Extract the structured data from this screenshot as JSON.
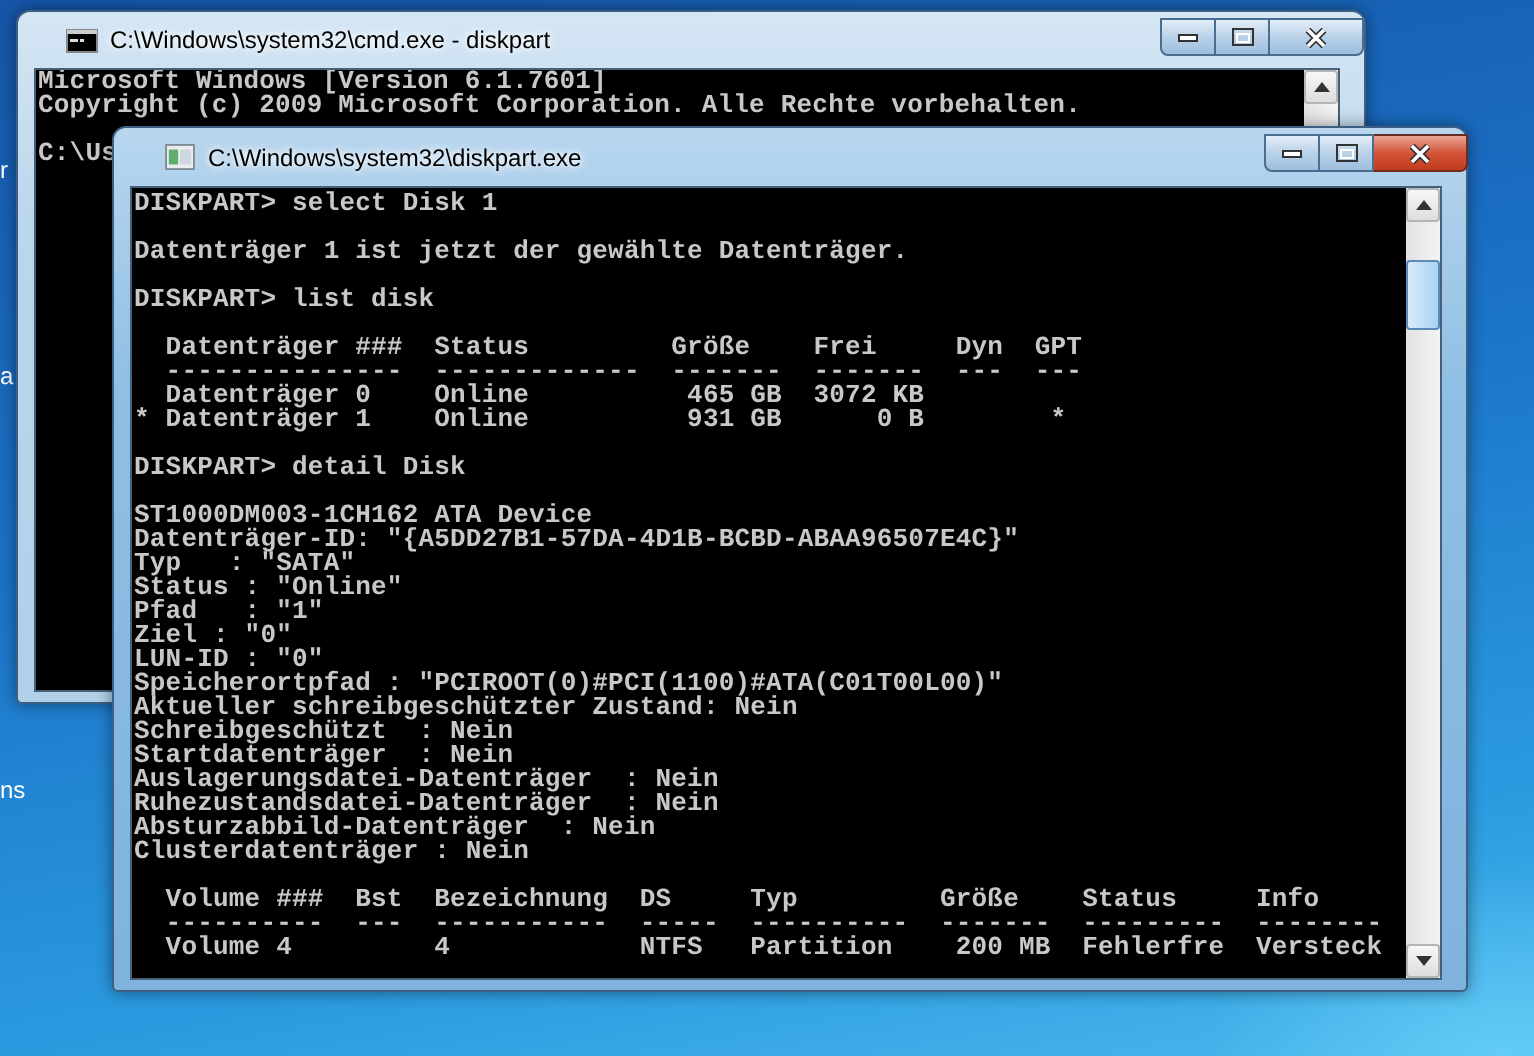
{
  "desktop_labels": [
    "r",
    "a",
    "ns"
  ],
  "windows": [
    {
      "title": "C:\\Windows\\system32\\cmd.exe - diskpart",
      "kind": "cmd",
      "active": false,
      "console": {
        "blocks": [
          [
            "Microsoft Windows [Version 6.1.7601]",
            "Copyright (c) 2009 Microsoft Corporation. Alle Rechte vorbehalten."
          ],
          [
            "C:\\Us"
          ]
        ]
      }
    },
    {
      "title": "C:\\Windows\\system32\\diskpart.exe",
      "kind": "diskpart",
      "active": true,
      "console": {
        "blocks": [
          [
            "DISKPART> select Disk 1"
          ],
          [
            "Datenträger 1 ist jetzt der gewählte Datenträger."
          ],
          [
            "DISKPART> list disk"
          ],
          [
            "  Datenträger ###  Status         Größe    Frei     Dyn  GPT",
            "  ---------------  -------------  -------  -------  ---  ---",
            "  Datenträger 0    Online          465 GB  3072 KB",
            "* Datenträger 1    Online          931 GB      0 B        *"
          ],
          [
            "DISKPART> detail Disk"
          ],
          [
            "ST1000DM003-1CH162 ATA Device",
            "Datenträger-ID: \"{A5DD27B1-57DA-4D1B-BCBD-ABAA96507E4C}\"",
            "Typ   : \"SATA\"",
            "Status : \"Online\"",
            "Pfad   : \"1\"",
            "Ziel : \"0\"",
            "LUN-ID : \"0\"",
            "Speicherortpfad : \"PCIROOT(0)#PCI(1100)#ATA(C01T00L00)\"",
            "Aktueller schreibgeschützter Zustand: Nein",
            "Schreibgeschützt  : Nein",
            "Startdatenträger  : Nein",
            "Auslagerungsdatei-Datenträger  : Nein",
            "Ruhezustandsdatei-Datenträger  : Nein",
            "Absturzabbild-Datenträger  : Nein",
            "Clusterdatenträger : Nein"
          ],
          [
            "  Volume ###  Bst  Bezeichnung  DS     Typ         Größe    Status     Info",
            "  ----------  ---  -----------  -----  ----------  -------  ---------  --------",
            "  Volume 4         4            NTFS   Partition    200 MB  Fehlerfre  Versteck"
          ]
        ]
      }
    }
  ]
}
